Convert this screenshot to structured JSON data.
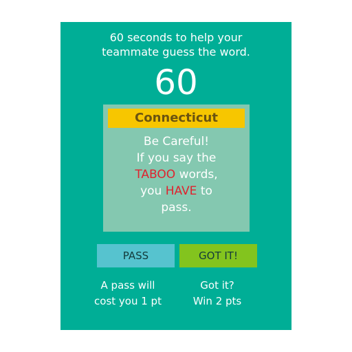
{
  "header": {
    "instruction_line1": "60 seconds to help your",
    "instruction_line2": "teammate guess the word.",
    "timer": "60"
  },
  "card": {
    "word": "Connecticut",
    "line1": "Be Careful!",
    "line2": "If you say the",
    "line3_highlight": "TABOO",
    "line3_rest": " words,",
    "line4_start": "you ",
    "line4_highlight": "HAVE",
    "line4_end": " to",
    "line5": "pass."
  },
  "buttons": {
    "pass_label": "PASS",
    "got_label": "GOT IT!"
  },
  "hints": {
    "pass_line1": "A pass will",
    "pass_line2": "cost you 1 pt",
    "got_line1": "Got it?",
    "got_line2": "Win 2 pts"
  },
  "colors": {
    "panel": "#00ae96",
    "card": "#84c8b0",
    "word_banner": "#f7c600",
    "pass_button": "#56c3cf",
    "got_button": "#83c41e",
    "highlight": "#e0222e"
  }
}
